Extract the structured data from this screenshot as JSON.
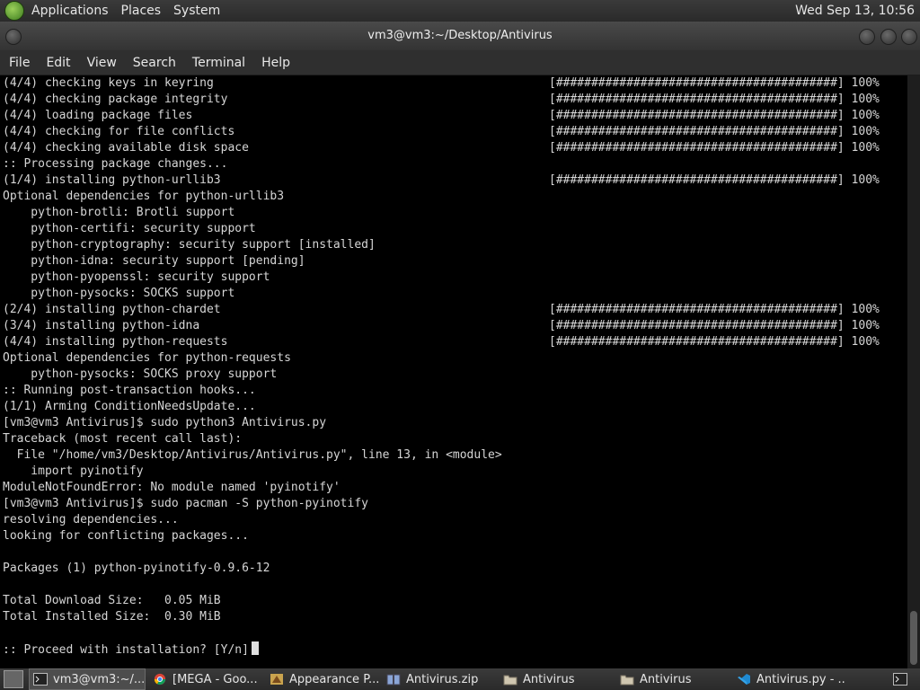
{
  "top_panel": {
    "menus": [
      "Applications",
      "Places",
      "System"
    ],
    "clock": "Wed Sep 13, 10:56"
  },
  "window": {
    "title": "vm3@vm3:~/Desktop/Antivirus",
    "menu": [
      "File",
      "Edit",
      "View",
      "Search",
      "Terminal",
      "Help"
    ]
  },
  "terminal": {
    "lines": [
      {
        "text": "(4/4) checking keys in keyring",
        "bar": "[########################################] 100%"
      },
      {
        "text": "(4/4) checking package integrity",
        "bar": "[########################################] 100%"
      },
      {
        "text": "(4/4) loading package files",
        "bar": "[########################################] 100%"
      },
      {
        "text": "(4/4) checking for file conflicts",
        "bar": "[########################################] 100%"
      },
      {
        "text": "(4/4) checking available disk space",
        "bar": "[########################################] 100%"
      },
      {
        "text": ":: Processing package changes...",
        "bar": ""
      },
      {
        "text": "(1/4) installing python-urllib3",
        "bar": "[########################################] 100%"
      },
      {
        "text": "Optional dependencies for python-urllib3",
        "bar": ""
      },
      {
        "text": "    python-brotli: Brotli support",
        "bar": ""
      },
      {
        "text": "    python-certifi: security support",
        "bar": ""
      },
      {
        "text": "    python-cryptography: security support [installed]",
        "bar": ""
      },
      {
        "text": "    python-idna: security support [pending]",
        "bar": ""
      },
      {
        "text": "    python-pyopenssl: security support",
        "bar": ""
      },
      {
        "text": "    python-pysocks: SOCKS support",
        "bar": ""
      },
      {
        "text": "(2/4) installing python-chardet",
        "bar": "[########################################] 100%"
      },
      {
        "text": "(3/4) installing python-idna",
        "bar": "[########################################] 100%"
      },
      {
        "text": "(4/4) installing python-requests",
        "bar": "[########################################] 100%"
      },
      {
        "text": "Optional dependencies for python-requests",
        "bar": ""
      },
      {
        "text": "    python-pysocks: SOCKS proxy support",
        "bar": ""
      },
      {
        "text": ":: Running post-transaction hooks...",
        "bar": ""
      },
      {
        "text": "(1/1) Arming ConditionNeedsUpdate...",
        "bar": ""
      },
      {
        "text": "[vm3@vm3 Antivirus]$ sudo python3 Antivirus.py",
        "bar": ""
      },
      {
        "text": "Traceback (most recent call last):",
        "bar": ""
      },
      {
        "text": "  File \"/home/vm3/Desktop/Antivirus/Antivirus.py\", line 13, in <module>",
        "bar": ""
      },
      {
        "text": "    import pyinotify",
        "bar": ""
      },
      {
        "text": "ModuleNotFoundError: No module named 'pyinotify'",
        "bar": ""
      },
      {
        "text": "[vm3@vm3 Antivirus]$ sudo pacman -S python-pyinotify",
        "bar": ""
      },
      {
        "text": "resolving dependencies...",
        "bar": ""
      },
      {
        "text": "looking for conflicting packages...",
        "bar": ""
      },
      {
        "text": "",
        "bar": ""
      },
      {
        "text": "Packages (1) python-pyinotify-0.9.6-12",
        "bar": ""
      },
      {
        "text": "",
        "bar": ""
      },
      {
        "text": "Total Download Size:   0.05 MiB",
        "bar": ""
      },
      {
        "text": "Total Installed Size:  0.30 MiB",
        "bar": ""
      },
      {
        "text": "",
        "bar": ""
      }
    ],
    "prompt": ":: Proceed with installation? [Y/n]"
  },
  "taskbar": {
    "items": [
      {
        "label": "vm3@vm3:~/...",
        "icon": "terminal-icon",
        "active": true
      },
      {
        "label": "[MEGA - Goo...",
        "icon": "chrome-icon",
        "active": false
      },
      {
        "label": "Appearance P...",
        "icon": "appearance-icon",
        "active": false
      },
      {
        "label": "Antivirus.zip",
        "icon": "archive-icon",
        "active": false
      },
      {
        "label": "Antivirus",
        "icon": "folder-icon",
        "active": false
      },
      {
        "label": "Antivirus",
        "icon": "folder-icon",
        "active": false
      },
      {
        "label": "Antivirus.py - ...",
        "icon": "vscode-icon",
        "active": false
      }
    ]
  }
}
